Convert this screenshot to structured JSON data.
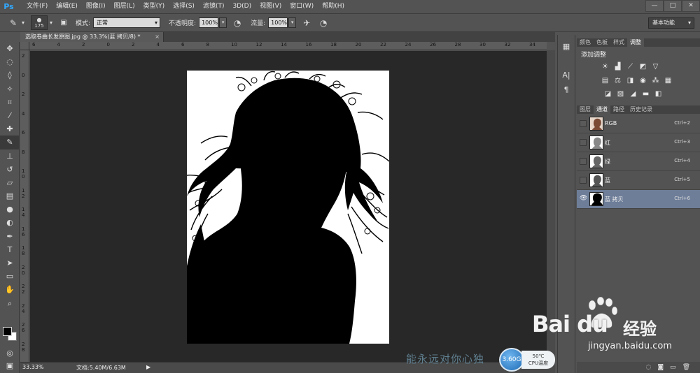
{
  "app": {
    "logo": "Ps"
  },
  "menu": [
    "文件(F)",
    "编辑(E)",
    "图像(I)",
    "图层(L)",
    "类型(Y)",
    "选择(S)",
    "滤镜(T)",
    "3D(D)",
    "视图(V)",
    "窗口(W)",
    "帮助(H)"
  ],
  "window_controls": {
    "min": "—",
    "max": "□",
    "close": "✕"
  },
  "options": {
    "brush_size": "175",
    "mode_label": "模式:",
    "mode_value": "正常",
    "opacity_label": "不透明度:",
    "opacity_value": "100%",
    "flow_label": "流量:",
    "flow_value": "100%",
    "workspace": "基本功能"
  },
  "document": {
    "tab_title": "选取卷曲长发原图.jpg @ 33.3%(蓝 拷贝/8) *",
    "tab_close": "×",
    "zoom": "33.33%",
    "doc_size": "文档:5.40M/6.63M",
    "status_arrow": "▶"
  },
  "rulers": {
    "top": [
      "6",
      "4",
      "2",
      "0",
      "2",
      "4",
      "6",
      "8",
      "10",
      "12",
      "14",
      "16",
      "18",
      "20",
      "22",
      "24",
      "26",
      "28",
      "30",
      "32",
      "34"
    ],
    "left": [
      "2",
      "0",
      "2",
      "4",
      "6",
      "8",
      "1 0",
      "1 2",
      "1 4",
      "1 6",
      "1 8",
      "2 0",
      "2 2",
      "2 4",
      "2 6",
      "2 8"
    ]
  },
  "tools": [
    "move-icon",
    "marquee-icon",
    "lasso-icon",
    "magic-wand-icon",
    "crop-icon",
    "eyedropper-icon",
    "healing-icon",
    "brush-icon",
    "stamp-icon",
    "history-brush-icon",
    "eraser-icon",
    "gradient-icon",
    "blur-icon",
    "dodge-icon",
    "pen-icon",
    "type-icon",
    "path-select-icon",
    "shape-icon",
    "hand-icon",
    "zoom-icon"
  ],
  "colors": {
    "foreground": "#000000",
    "background": "#ffffff"
  },
  "adjustments": {
    "tabs": [
      "颜色",
      "色板",
      "样式",
      "调整"
    ],
    "active_tab": "调整",
    "title": "添加调整"
  },
  "channels": {
    "tabs": [
      "图层",
      "通道",
      "路径",
      "历史记录"
    ],
    "active_tab": "通道",
    "rows": [
      {
        "name": "RGB",
        "shortcut": "Ctrl+2",
        "visible": false,
        "selected": false
      },
      {
        "name": "红",
        "shortcut": "Ctrl+3",
        "visible": false,
        "selected": false
      },
      {
        "name": "绿",
        "shortcut": "Ctrl+4",
        "visible": false,
        "selected": false
      },
      {
        "name": "蓝",
        "shortcut": "Ctrl+5",
        "visible": false,
        "selected": false
      },
      {
        "name": "蓝 拷贝",
        "shortcut": "Ctrl+6",
        "visible": true,
        "selected": true
      }
    ]
  },
  "overlay": {
    "caption": "能永远对你心独",
    "cpu_speed": "3.60G",
    "cpu_temp": "50℃",
    "cpu_label": "CPU温度",
    "baidu_logo": "Bai du",
    "baidu_sub": "经验",
    "baidu_url": "jingyan.baidu.com"
  }
}
